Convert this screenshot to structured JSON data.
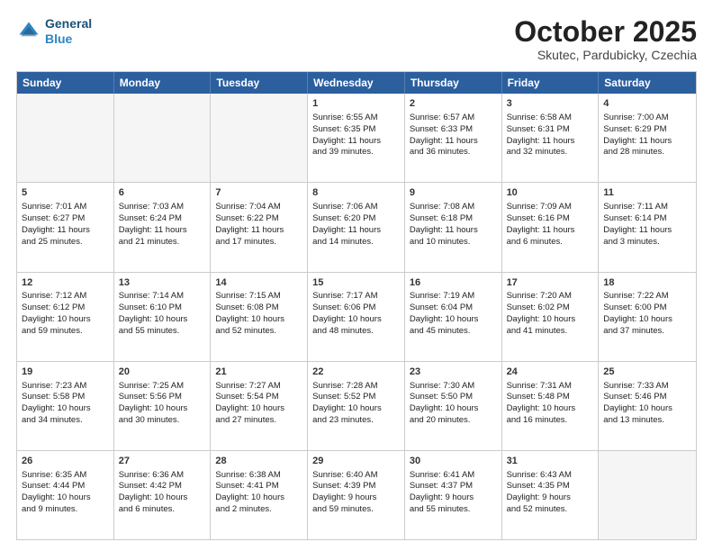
{
  "header": {
    "logo_line1": "General",
    "logo_line2": "Blue",
    "month": "October 2025",
    "location": "Skutec, Pardubicky, Czechia"
  },
  "weekdays": [
    "Sunday",
    "Monday",
    "Tuesday",
    "Wednesday",
    "Thursday",
    "Friday",
    "Saturday"
  ],
  "rows": [
    [
      {
        "day": "",
        "lines": []
      },
      {
        "day": "",
        "lines": []
      },
      {
        "day": "",
        "lines": []
      },
      {
        "day": "1",
        "lines": [
          "Sunrise: 6:55 AM",
          "Sunset: 6:35 PM",
          "Daylight: 11 hours",
          "and 39 minutes."
        ]
      },
      {
        "day": "2",
        "lines": [
          "Sunrise: 6:57 AM",
          "Sunset: 6:33 PM",
          "Daylight: 11 hours",
          "and 36 minutes."
        ]
      },
      {
        "day": "3",
        "lines": [
          "Sunrise: 6:58 AM",
          "Sunset: 6:31 PM",
          "Daylight: 11 hours",
          "and 32 minutes."
        ]
      },
      {
        "day": "4",
        "lines": [
          "Sunrise: 7:00 AM",
          "Sunset: 6:29 PM",
          "Daylight: 11 hours",
          "and 28 minutes."
        ]
      }
    ],
    [
      {
        "day": "5",
        "lines": [
          "Sunrise: 7:01 AM",
          "Sunset: 6:27 PM",
          "Daylight: 11 hours",
          "and 25 minutes."
        ]
      },
      {
        "day": "6",
        "lines": [
          "Sunrise: 7:03 AM",
          "Sunset: 6:24 PM",
          "Daylight: 11 hours",
          "and 21 minutes."
        ]
      },
      {
        "day": "7",
        "lines": [
          "Sunrise: 7:04 AM",
          "Sunset: 6:22 PM",
          "Daylight: 11 hours",
          "and 17 minutes."
        ]
      },
      {
        "day": "8",
        "lines": [
          "Sunrise: 7:06 AM",
          "Sunset: 6:20 PM",
          "Daylight: 11 hours",
          "and 14 minutes."
        ]
      },
      {
        "day": "9",
        "lines": [
          "Sunrise: 7:08 AM",
          "Sunset: 6:18 PM",
          "Daylight: 11 hours",
          "and 10 minutes."
        ]
      },
      {
        "day": "10",
        "lines": [
          "Sunrise: 7:09 AM",
          "Sunset: 6:16 PM",
          "Daylight: 11 hours",
          "and 6 minutes."
        ]
      },
      {
        "day": "11",
        "lines": [
          "Sunrise: 7:11 AM",
          "Sunset: 6:14 PM",
          "Daylight: 11 hours",
          "and 3 minutes."
        ]
      }
    ],
    [
      {
        "day": "12",
        "lines": [
          "Sunrise: 7:12 AM",
          "Sunset: 6:12 PM",
          "Daylight: 10 hours",
          "and 59 minutes."
        ]
      },
      {
        "day": "13",
        "lines": [
          "Sunrise: 7:14 AM",
          "Sunset: 6:10 PM",
          "Daylight: 10 hours",
          "and 55 minutes."
        ]
      },
      {
        "day": "14",
        "lines": [
          "Sunrise: 7:15 AM",
          "Sunset: 6:08 PM",
          "Daylight: 10 hours",
          "and 52 minutes."
        ]
      },
      {
        "day": "15",
        "lines": [
          "Sunrise: 7:17 AM",
          "Sunset: 6:06 PM",
          "Daylight: 10 hours",
          "and 48 minutes."
        ]
      },
      {
        "day": "16",
        "lines": [
          "Sunrise: 7:19 AM",
          "Sunset: 6:04 PM",
          "Daylight: 10 hours",
          "and 45 minutes."
        ]
      },
      {
        "day": "17",
        "lines": [
          "Sunrise: 7:20 AM",
          "Sunset: 6:02 PM",
          "Daylight: 10 hours",
          "and 41 minutes."
        ]
      },
      {
        "day": "18",
        "lines": [
          "Sunrise: 7:22 AM",
          "Sunset: 6:00 PM",
          "Daylight: 10 hours",
          "and 37 minutes."
        ]
      }
    ],
    [
      {
        "day": "19",
        "lines": [
          "Sunrise: 7:23 AM",
          "Sunset: 5:58 PM",
          "Daylight: 10 hours",
          "and 34 minutes."
        ]
      },
      {
        "day": "20",
        "lines": [
          "Sunrise: 7:25 AM",
          "Sunset: 5:56 PM",
          "Daylight: 10 hours",
          "and 30 minutes."
        ]
      },
      {
        "day": "21",
        "lines": [
          "Sunrise: 7:27 AM",
          "Sunset: 5:54 PM",
          "Daylight: 10 hours",
          "and 27 minutes."
        ]
      },
      {
        "day": "22",
        "lines": [
          "Sunrise: 7:28 AM",
          "Sunset: 5:52 PM",
          "Daylight: 10 hours",
          "and 23 minutes."
        ]
      },
      {
        "day": "23",
        "lines": [
          "Sunrise: 7:30 AM",
          "Sunset: 5:50 PM",
          "Daylight: 10 hours",
          "and 20 minutes."
        ]
      },
      {
        "day": "24",
        "lines": [
          "Sunrise: 7:31 AM",
          "Sunset: 5:48 PM",
          "Daylight: 10 hours",
          "and 16 minutes."
        ]
      },
      {
        "day": "25",
        "lines": [
          "Sunrise: 7:33 AM",
          "Sunset: 5:46 PM",
          "Daylight: 10 hours",
          "and 13 minutes."
        ]
      }
    ],
    [
      {
        "day": "26",
        "lines": [
          "Sunrise: 6:35 AM",
          "Sunset: 4:44 PM",
          "Daylight: 10 hours",
          "and 9 minutes."
        ]
      },
      {
        "day": "27",
        "lines": [
          "Sunrise: 6:36 AM",
          "Sunset: 4:42 PM",
          "Daylight: 10 hours",
          "and 6 minutes."
        ]
      },
      {
        "day": "28",
        "lines": [
          "Sunrise: 6:38 AM",
          "Sunset: 4:41 PM",
          "Daylight: 10 hours",
          "and 2 minutes."
        ]
      },
      {
        "day": "29",
        "lines": [
          "Sunrise: 6:40 AM",
          "Sunset: 4:39 PM",
          "Daylight: 9 hours",
          "and 59 minutes."
        ]
      },
      {
        "day": "30",
        "lines": [
          "Sunrise: 6:41 AM",
          "Sunset: 4:37 PM",
          "Daylight: 9 hours",
          "and 55 minutes."
        ]
      },
      {
        "day": "31",
        "lines": [
          "Sunrise: 6:43 AM",
          "Sunset: 4:35 PM",
          "Daylight: 9 hours",
          "and 52 minutes."
        ]
      },
      {
        "day": "",
        "lines": []
      }
    ]
  ]
}
